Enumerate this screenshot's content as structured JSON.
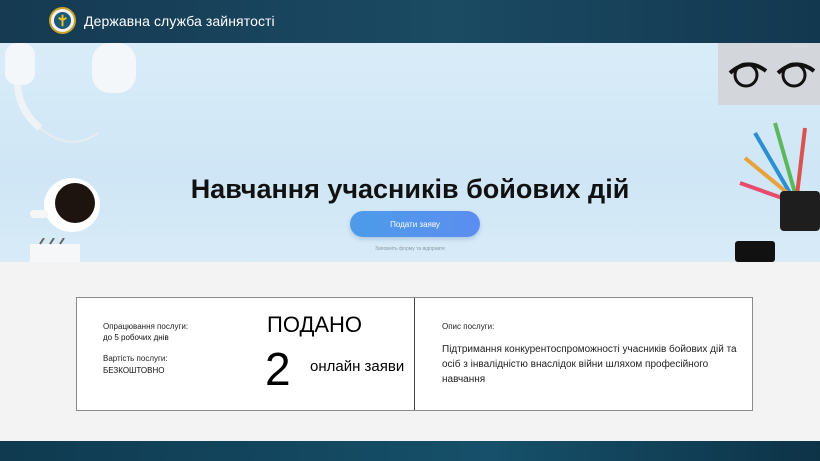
{
  "header": {
    "brand": "Державна служба зайнятості",
    "logo_icon": "emblem-icon"
  },
  "hero": {
    "title": "Навчання учасників бойових дій",
    "cta_label": "Подати заяву",
    "cta_hint": "Заповніть форму та відправте"
  },
  "service": {
    "processing_label": "Опрацювання послуги:",
    "processing_value": "до 5 робочих днів",
    "cost_label": "Вартість послуги:",
    "cost_value": "БЕЗКОШТОВНО",
    "submitted_label": "ПОДАНО",
    "submitted_count": "2",
    "submitted_unit": "онлайн заяви",
    "description_label": "Опис послуги:",
    "description": "Підтримання конкурентоспроможності учасників бойових дій та осіб з інвалідністю внаслідок війни шляхом професійного навчання"
  },
  "colors": {
    "header": "#1b4a63",
    "cta": "#4d9be9",
    "hero_bg": "#d9ecf8"
  }
}
